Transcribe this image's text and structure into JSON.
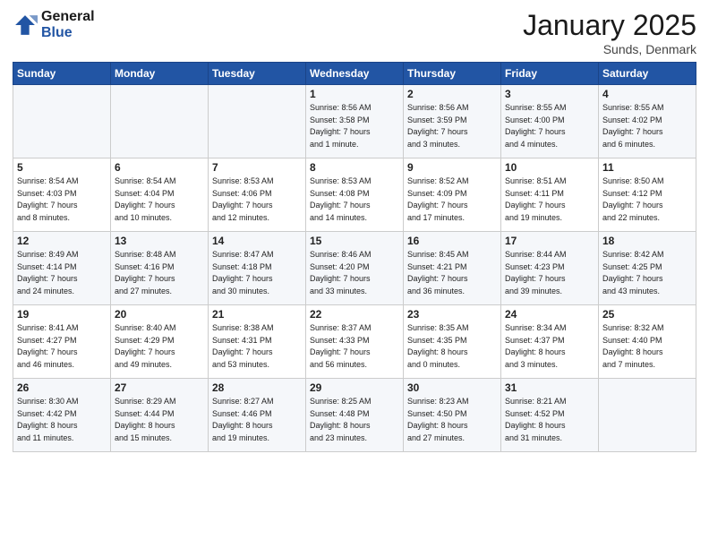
{
  "logo": {
    "line1": "General",
    "line2": "Blue"
  },
  "title": "January 2025",
  "location": "Sunds, Denmark",
  "weekdays": [
    "Sunday",
    "Monday",
    "Tuesday",
    "Wednesday",
    "Thursday",
    "Friday",
    "Saturday"
  ],
  "weeks": [
    [
      {
        "day": "",
        "info": ""
      },
      {
        "day": "",
        "info": ""
      },
      {
        "day": "",
        "info": ""
      },
      {
        "day": "1",
        "info": "Sunrise: 8:56 AM\nSunset: 3:58 PM\nDaylight: 7 hours\nand 1 minute."
      },
      {
        "day": "2",
        "info": "Sunrise: 8:56 AM\nSunset: 3:59 PM\nDaylight: 7 hours\nand 3 minutes."
      },
      {
        "day": "3",
        "info": "Sunrise: 8:55 AM\nSunset: 4:00 PM\nDaylight: 7 hours\nand 4 minutes."
      },
      {
        "day": "4",
        "info": "Sunrise: 8:55 AM\nSunset: 4:02 PM\nDaylight: 7 hours\nand 6 minutes."
      }
    ],
    [
      {
        "day": "5",
        "info": "Sunrise: 8:54 AM\nSunset: 4:03 PM\nDaylight: 7 hours\nand 8 minutes."
      },
      {
        "day": "6",
        "info": "Sunrise: 8:54 AM\nSunset: 4:04 PM\nDaylight: 7 hours\nand 10 minutes."
      },
      {
        "day": "7",
        "info": "Sunrise: 8:53 AM\nSunset: 4:06 PM\nDaylight: 7 hours\nand 12 minutes."
      },
      {
        "day": "8",
        "info": "Sunrise: 8:53 AM\nSunset: 4:08 PM\nDaylight: 7 hours\nand 14 minutes."
      },
      {
        "day": "9",
        "info": "Sunrise: 8:52 AM\nSunset: 4:09 PM\nDaylight: 7 hours\nand 17 minutes."
      },
      {
        "day": "10",
        "info": "Sunrise: 8:51 AM\nSunset: 4:11 PM\nDaylight: 7 hours\nand 19 minutes."
      },
      {
        "day": "11",
        "info": "Sunrise: 8:50 AM\nSunset: 4:12 PM\nDaylight: 7 hours\nand 22 minutes."
      }
    ],
    [
      {
        "day": "12",
        "info": "Sunrise: 8:49 AM\nSunset: 4:14 PM\nDaylight: 7 hours\nand 24 minutes."
      },
      {
        "day": "13",
        "info": "Sunrise: 8:48 AM\nSunset: 4:16 PM\nDaylight: 7 hours\nand 27 minutes."
      },
      {
        "day": "14",
        "info": "Sunrise: 8:47 AM\nSunset: 4:18 PM\nDaylight: 7 hours\nand 30 minutes."
      },
      {
        "day": "15",
        "info": "Sunrise: 8:46 AM\nSunset: 4:20 PM\nDaylight: 7 hours\nand 33 minutes."
      },
      {
        "day": "16",
        "info": "Sunrise: 8:45 AM\nSunset: 4:21 PM\nDaylight: 7 hours\nand 36 minutes."
      },
      {
        "day": "17",
        "info": "Sunrise: 8:44 AM\nSunset: 4:23 PM\nDaylight: 7 hours\nand 39 minutes."
      },
      {
        "day": "18",
        "info": "Sunrise: 8:42 AM\nSunset: 4:25 PM\nDaylight: 7 hours\nand 43 minutes."
      }
    ],
    [
      {
        "day": "19",
        "info": "Sunrise: 8:41 AM\nSunset: 4:27 PM\nDaylight: 7 hours\nand 46 minutes."
      },
      {
        "day": "20",
        "info": "Sunrise: 8:40 AM\nSunset: 4:29 PM\nDaylight: 7 hours\nand 49 minutes."
      },
      {
        "day": "21",
        "info": "Sunrise: 8:38 AM\nSunset: 4:31 PM\nDaylight: 7 hours\nand 53 minutes."
      },
      {
        "day": "22",
        "info": "Sunrise: 8:37 AM\nSunset: 4:33 PM\nDaylight: 7 hours\nand 56 minutes."
      },
      {
        "day": "23",
        "info": "Sunrise: 8:35 AM\nSunset: 4:35 PM\nDaylight: 8 hours\nand 0 minutes."
      },
      {
        "day": "24",
        "info": "Sunrise: 8:34 AM\nSunset: 4:37 PM\nDaylight: 8 hours\nand 3 minutes."
      },
      {
        "day": "25",
        "info": "Sunrise: 8:32 AM\nSunset: 4:40 PM\nDaylight: 8 hours\nand 7 minutes."
      }
    ],
    [
      {
        "day": "26",
        "info": "Sunrise: 8:30 AM\nSunset: 4:42 PM\nDaylight: 8 hours\nand 11 minutes."
      },
      {
        "day": "27",
        "info": "Sunrise: 8:29 AM\nSunset: 4:44 PM\nDaylight: 8 hours\nand 15 minutes."
      },
      {
        "day": "28",
        "info": "Sunrise: 8:27 AM\nSunset: 4:46 PM\nDaylight: 8 hours\nand 19 minutes."
      },
      {
        "day": "29",
        "info": "Sunrise: 8:25 AM\nSunset: 4:48 PM\nDaylight: 8 hours\nand 23 minutes."
      },
      {
        "day": "30",
        "info": "Sunrise: 8:23 AM\nSunset: 4:50 PM\nDaylight: 8 hours\nand 27 minutes."
      },
      {
        "day": "31",
        "info": "Sunrise: 8:21 AM\nSunset: 4:52 PM\nDaylight: 8 hours\nand 31 minutes."
      },
      {
        "day": "",
        "info": ""
      }
    ]
  ]
}
